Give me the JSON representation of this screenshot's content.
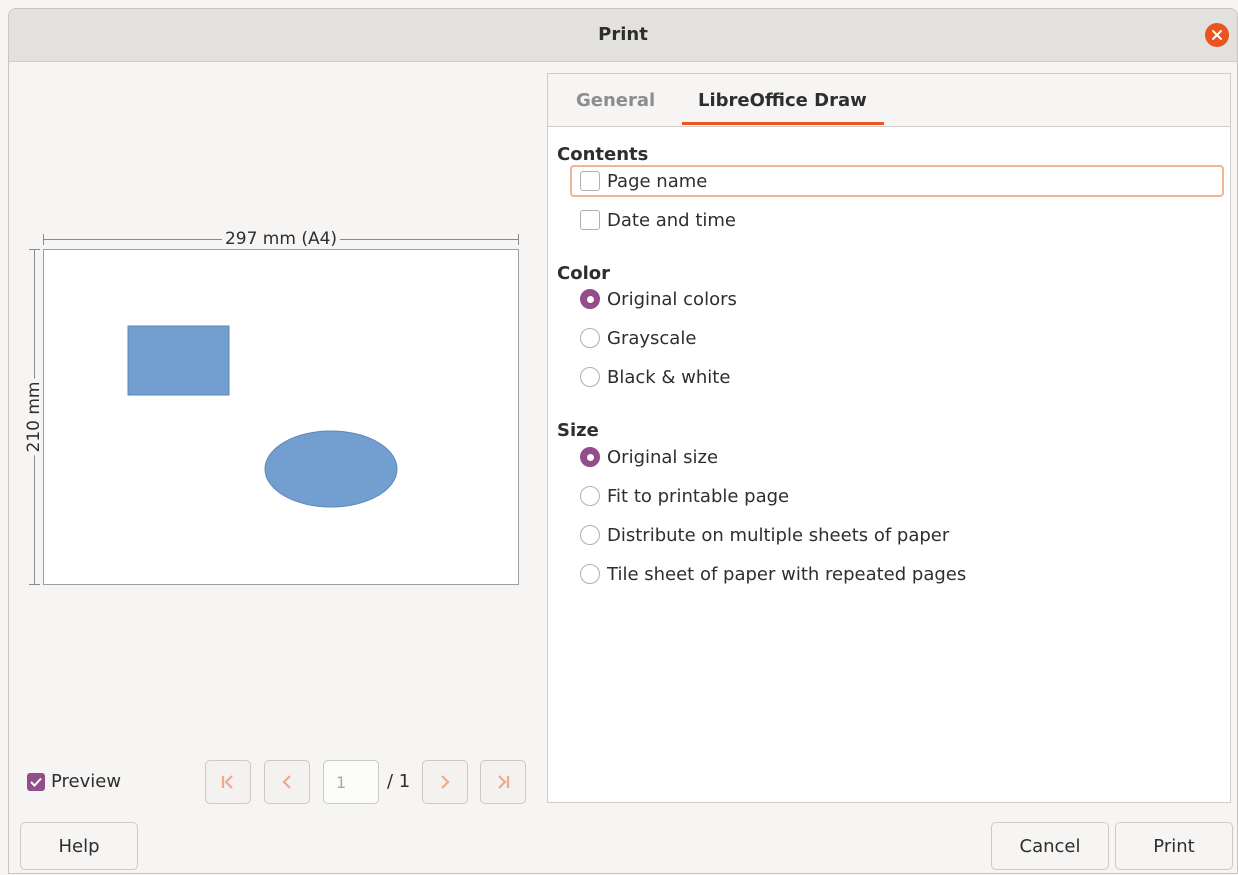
{
  "window": {
    "title": "Print"
  },
  "preview": {
    "width_label": "297 mm (A4)",
    "height_label": "210 mm",
    "shape_color": "#729fcf",
    "preview_checkbox": {
      "label": "Preview",
      "checked": true
    },
    "pagination": {
      "current_page": "1",
      "total": "/ 1"
    }
  },
  "tabs": [
    {
      "label": "General",
      "active": false
    },
    {
      "label": "LibreOffice Draw",
      "active": true
    }
  ],
  "sections": {
    "contents": {
      "title": "Contents",
      "options": [
        {
          "label": "Page name",
          "checked": false
        },
        {
          "label": "Date and time",
          "checked": false
        }
      ]
    },
    "color": {
      "title": "Color",
      "options": [
        {
          "label": "Original colors",
          "selected": true
        },
        {
          "label": "Grayscale",
          "selected": false
        },
        {
          "label": "Black & white",
          "selected": false
        }
      ]
    },
    "size": {
      "title": "Size",
      "options": [
        {
          "label": "Original size",
          "selected": true
        },
        {
          "label": "Fit to printable page",
          "selected": false
        },
        {
          "label": "Distribute on multiple sheets of paper",
          "selected": false
        },
        {
          "label": "Tile sheet of paper with repeated pages",
          "selected": false
        }
      ]
    }
  },
  "footer": {
    "help_label": "Help",
    "cancel_label": "Cancel",
    "print_label": "Print"
  },
  "colors": {
    "accent": "#924d8b",
    "tab_underline": "#e95420",
    "close": "#e95420"
  }
}
